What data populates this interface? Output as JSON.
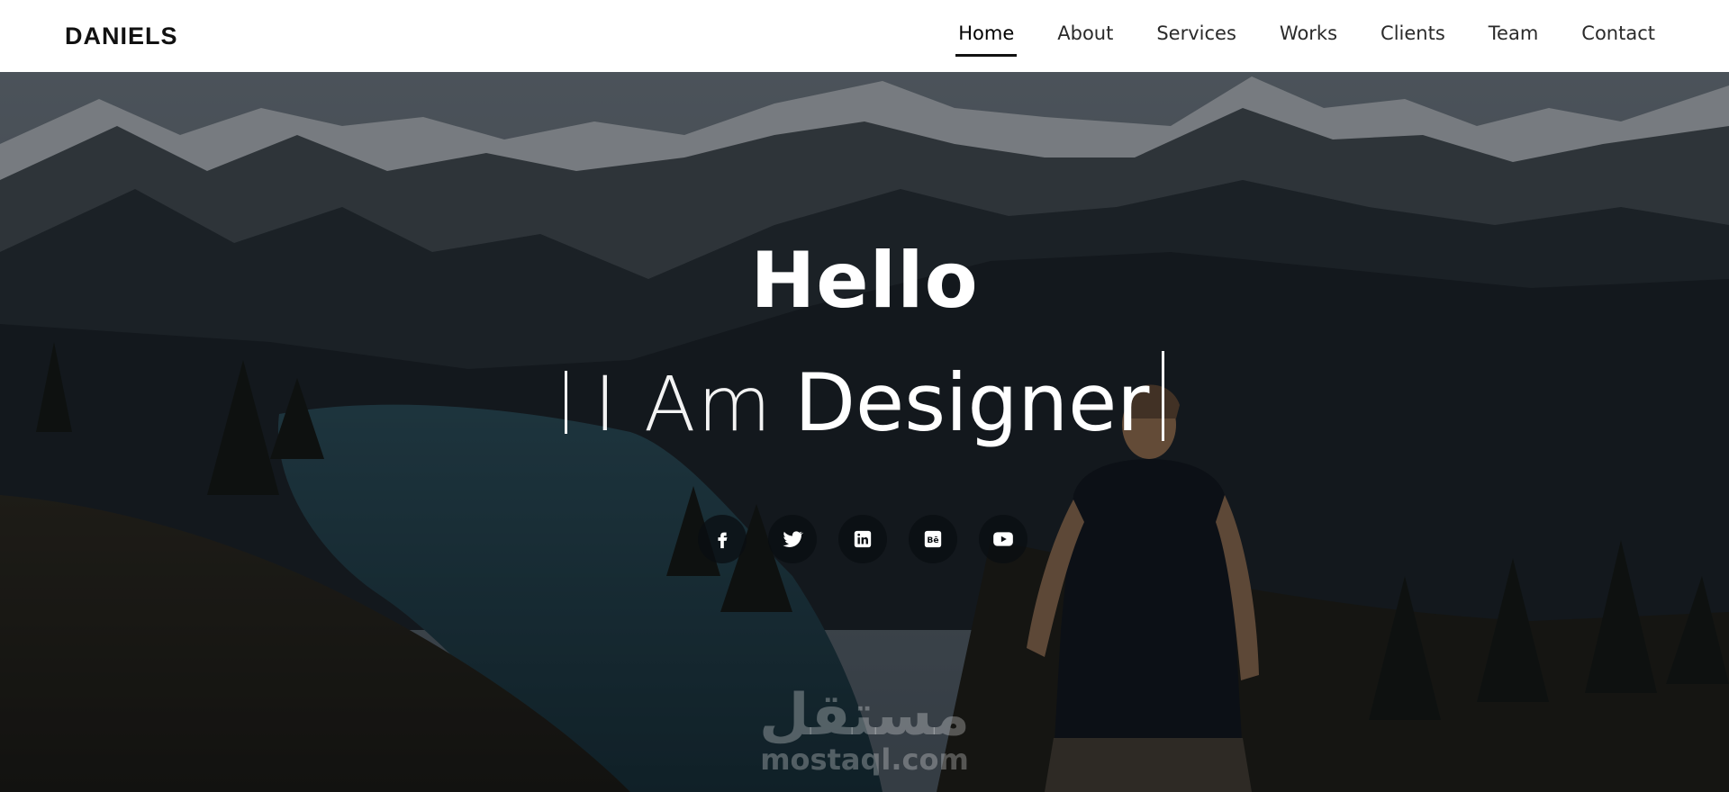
{
  "navbar": {
    "brand": "DANIELS",
    "links": [
      {
        "label": "Home",
        "active": true
      },
      {
        "label": "About",
        "active": false
      },
      {
        "label": "Services",
        "active": false
      },
      {
        "label": "Works",
        "active": false
      },
      {
        "label": "Clients",
        "active": false
      },
      {
        "label": "Team",
        "active": false
      },
      {
        "label": "Contact",
        "active": false
      }
    ]
  },
  "hero": {
    "greeting": "Hello",
    "prefix": "I Am",
    "typed_word": "Designer",
    "socials": [
      {
        "icon": "facebook-icon"
      },
      {
        "icon": "twitter-icon"
      },
      {
        "icon": "linkedin-icon"
      },
      {
        "icon": "behance-icon"
      },
      {
        "icon": "youtube-icon"
      }
    ]
  },
  "watermark": {
    "arabic": "مستقل",
    "latin": "mostaql.com"
  },
  "colors": {
    "navbar_bg": "#ffffff",
    "text_dark": "#111111",
    "hero_text": "#ffffff",
    "social_bg": "#0a0e12"
  }
}
